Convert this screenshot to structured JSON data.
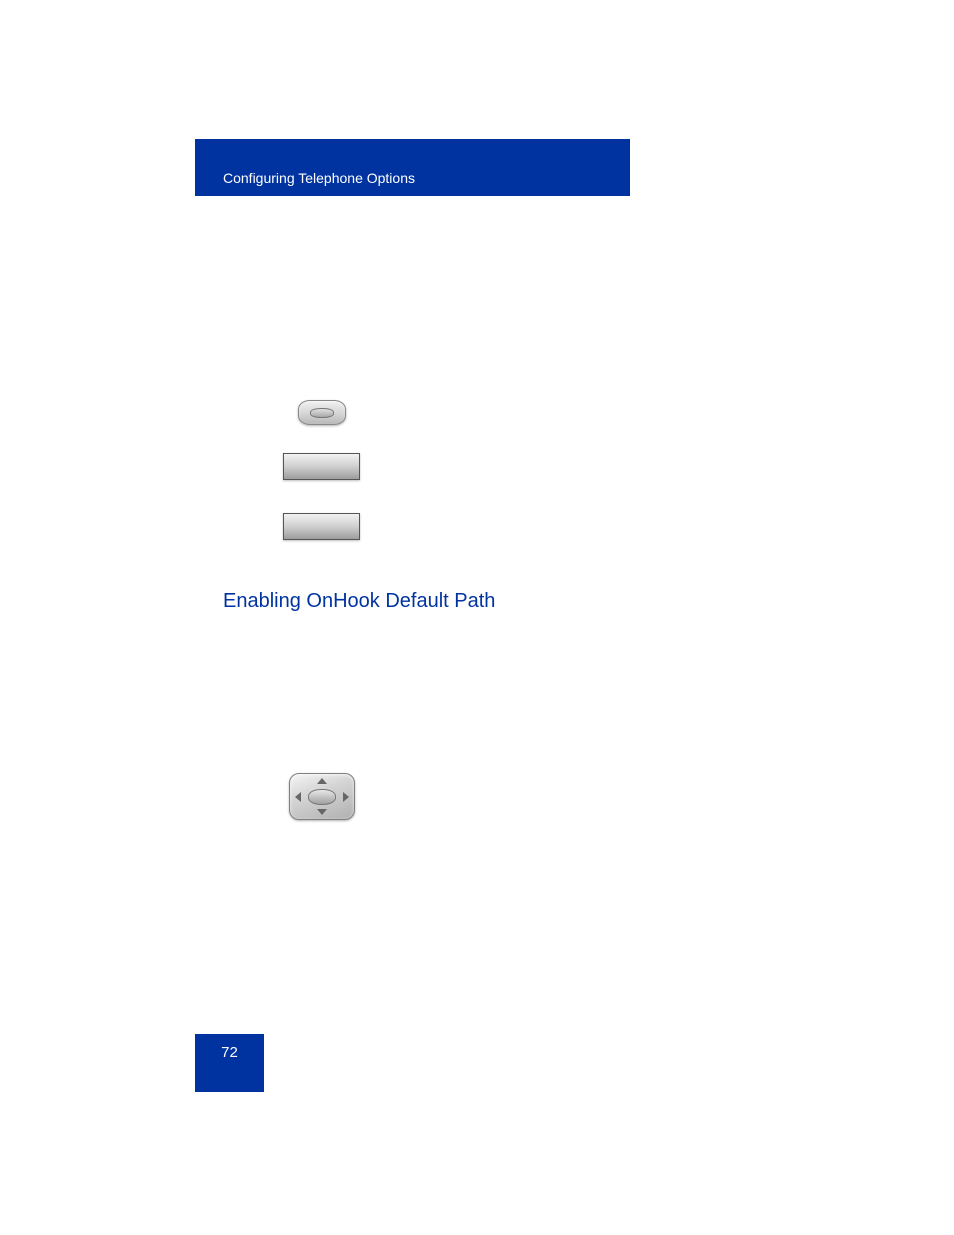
{
  "header": {
    "title": "Configuring Telephone Options"
  },
  "section": {
    "heading": "Enabling OnHook Default Path"
  },
  "footer": {
    "page_number": "72"
  },
  "icons": {
    "enter_key": "enter-key",
    "softkey_1": "softkey",
    "softkey_2": "softkey",
    "nav_cluster": "navigation-cluster"
  }
}
